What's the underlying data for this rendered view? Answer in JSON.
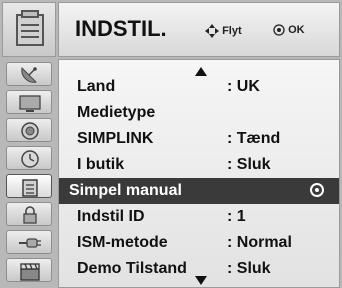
{
  "header": {
    "title": "INDSTIL.",
    "nav_hint": "Flyt",
    "ok_hint": "OK"
  },
  "sidebar": {
    "items": [
      {
        "icon": "satellite-dish-icon"
      },
      {
        "icon": "tv-screen-icon"
      },
      {
        "icon": "speaker-icon"
      },
      {
        "icon": "clock-icon"
      },
      {
        "icon": "settings-icon",
        "active": true
      },
      {
        "icon": "lock-icon"
      },
      {
        "icon": "input-cable-icon"
      },
      {
        "icon": "clapperboard-icon"
      }
    ]
  },
  "menu": {
    "items": [
      {
        "label": "Land",
        "value": ": UK"
      },
      {
        "label": "Medietype",
        "value": ""
      },
      {
        "label": "SIMPLINK",
        "value": ": Tænd"
      },
      {
        "label": "I butik",
        "value": ": Sluk"
      },
      {
        "label": "Simpel manual",
        "value": "",
        "selected": true
      },
      {
        "label": "Indstil ID",
        "value": ": 1"
      },
      {
        "label": "ISM-metode",
        "value": ": Normal"
      },
      {
        "label": "Demo Tilstand",
        "value": ": Sluk"
      }
    ]
  },
  "colors": {
    "frame": "#b8b8b8",
    "highlight": "#3a3a3a",
    "text": "#111111"
  }
}
